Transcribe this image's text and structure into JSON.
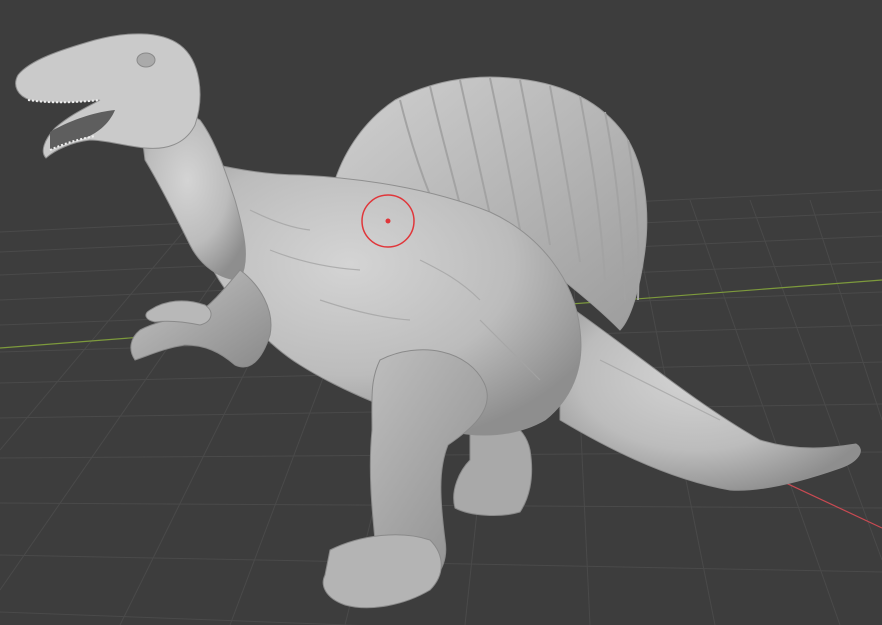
{
  "viewport": {
    "background": "#3d3d3d",
    "grid_color": "#4a4a4a",
    "x_axis_color": "#c94a52",
    "y_axis_color": "#7d9a3c",
    "model_color": "#c8c8c8",
    "model_shadow_color": "#8f8f8f",
    "brush_cursor_color": "#e0363a",
    "brush_cursor_icon": "circle-brush-cursor"
  }
}
